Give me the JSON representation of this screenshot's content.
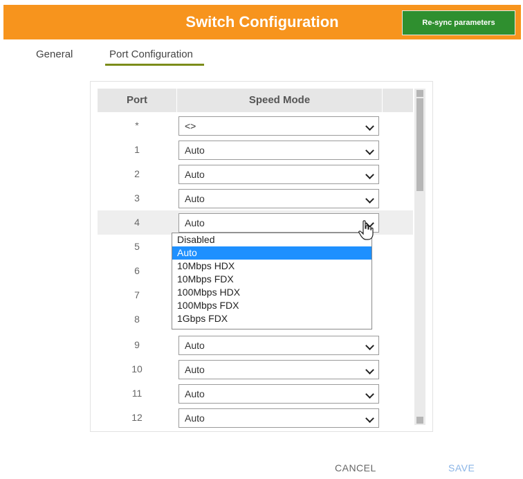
{
  "header": {
    "title": "Switch Configuration",
    "resync_label": "Re-sync parameters",
    "bg_color": "#f7941d",
    "resync_color": "#2f8f2f"
  },
  "tabs": [
    {
      "label": "General",
      "active": false
    },
    {
      "label": "Port Configuration",
      "active": true
    }
  ],
  "table": {
    "columns": [
      "Port",
      "Speed Mode"
    ],
    "rows": [
      {
        "port": "*",
        "speed": "<>"
      },
      {
        "port": "1",
        "speed": "Auto"
      },
      {
        "port": "2",
        "speed": "Auto"
      },
      {
        "port": "3",
        "speed": "Auto"
      },
      {
        "port": "4",
        "speed": "Auto"
      },
      {
        "port": "5",
        "speed": ""
      },
      {
        "port": "6",
        "speed": ""
      },
      {
        "port": "7",
        "speed": ""
      },
      {
        "port": "8",
        "speed": ""
      },
      {
        "port": "9",
        "speed": "Auto"
      },
      {
        "port": "10",
        "speed": "Auto"
      },
      {
        "port": "11",
        "speed": "Auto"
      },
      {
        "port": "12",
        "speed": "Auto"
      }
    ]
  },
  "dropdown": {
    "open_for_port": "4",
    "selected": "Auto",
    "options": [
      "Disabled",
      "Auto",
      "10Mbps HDX",
      "10Mbps FDX",
      "100Mbps HDX",
      "100Mbps FDX",
      "1Gbps FDX"
    ]
  },
  "footer": {
    "cancel_label": "CANCEL",
    "save_label": "SAVE"
  }
}
